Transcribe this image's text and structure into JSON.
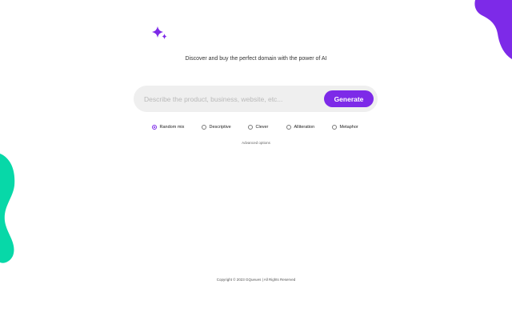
{
  "brand": {
    "logo_icon": "sparkle-icon",
    "accent_color": "#7d2ae8"
  },
  "decorations": {
    "top_right_blob_color": "#7d2ae8",
    "left_blob_color": "#07d8a8"
  },
  "hero": {
    "tagline": "Discover and buy the perfect domain with the power of AI"
  },
  "search": {
    "placeholder": "Describe the product, business, website, etc...",
    "value": "",
    "button_label": "Generate"
  },
  "style_options": [
    {
      "label": "Random mix",
      "selected": true
    },
    {
      "label": "Descriptive",
      "selected": false
    },
    {
      "label": "Clever",
      "selected": false
    },
    {
      "label": "Alliteration",
      "selected": false
    },
    {
      "label": "Metaphor",
      "selected": false
    }
  ],
  "advanced_options_label": "Advanced options",
  "footer": {
    "copyright": "Copyright © 2023 GQueues | All Rights Reserved"
  }
}
